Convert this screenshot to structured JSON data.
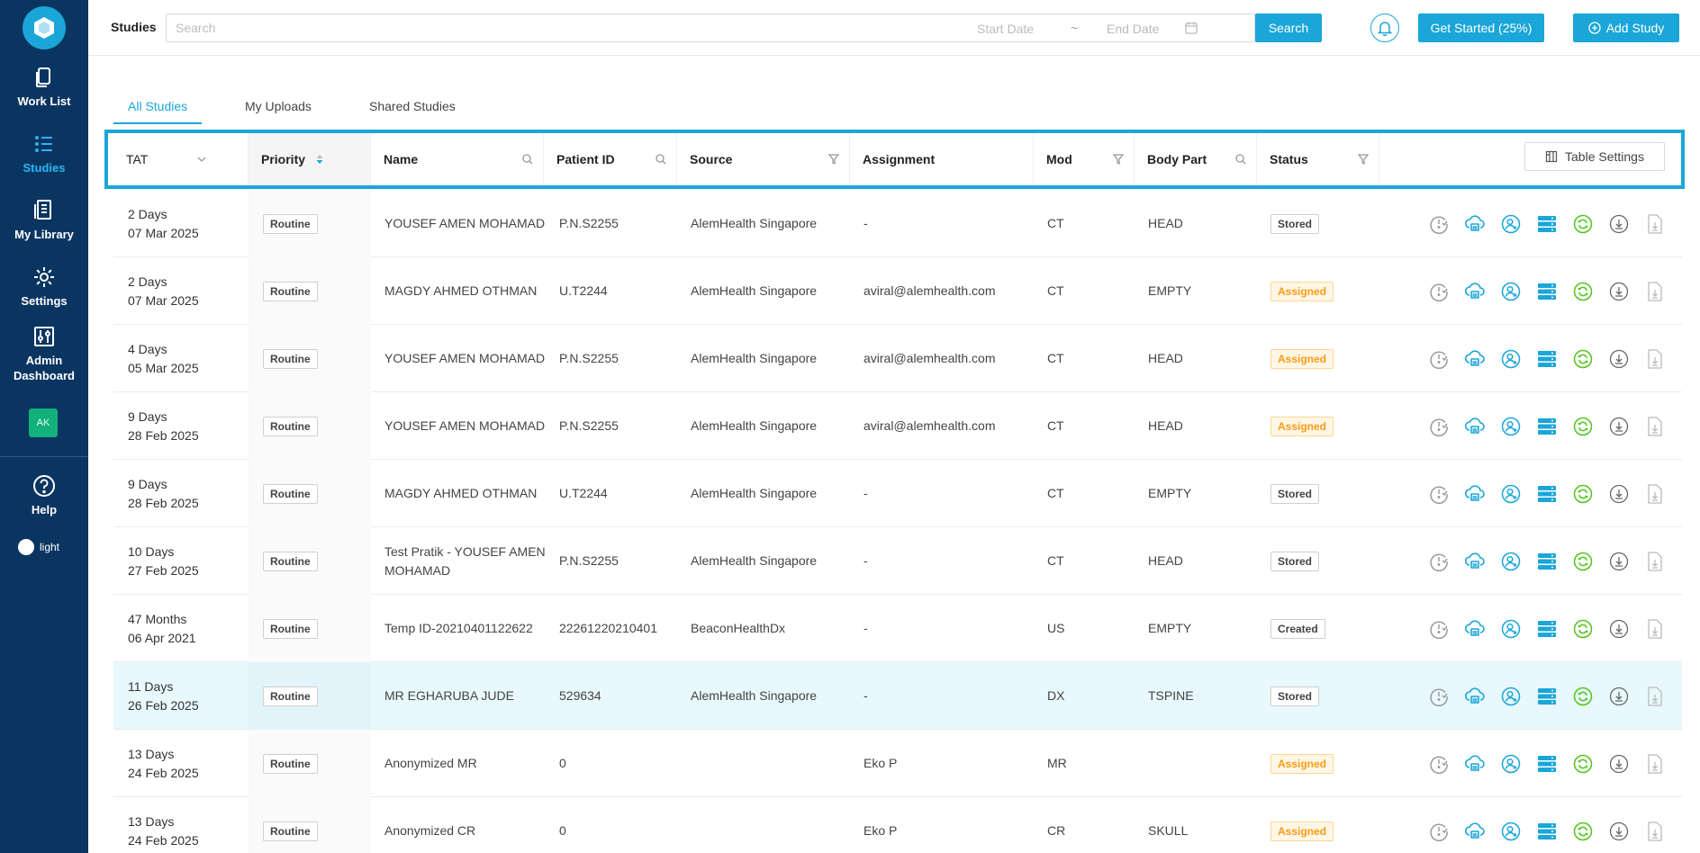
{
  "sidebar": {
    "items": [
      {
        "label": "Work List",
        "icon": "worklist-icon"
      },
      {
        "label": "Studies",
        "icon": "list-icon"
      },
      {
        "label": "My Library",
        "icon": "library-icon"
      },
      {
        "label": "Settings",
        "icon": "gear-icon"
      },
      {
        "label": "Admin Dashboard",
        "icon": "sliders-icon"
      }
    ],
    "avatar": "AK",
    "help": "Help",
    "theme": "light"
  },
  "topbar": {
    "title": "Studies",
    "search_placeholder": "Search",
    "start_date": "Start Date",
    "separator": "~",
    "end_date": "End Date",
    "search_button": "Search",
    "get_started": "Get Started (25%)",
    "add_study": "Add Study"
  },
  "tabs": [
    "All Studies",
    "My Uploads",
    "Shared Studies"
  ],
  "table": {
    "headers": {
      "tat": "TAT",
      "priority": "Priority",
      "name": "Name",
      "patient_id": "Patient ID",
      "source": "Source",
      "assignment": "Assignment",
      "mod": "Mod",
      "body_part": "Body Part",
      "status": "Status"
    },
    "table_settings": "Table Settings",
    "rows": [
      {
        "tat": "2 Days",
        "date": "07 Mar 2025",
        "priority": "Routine",
        "name": "YOUSEF AMEN MOHAMAD",
        "patient_id": "P.N.S2255",
        "source": "AlemHealth Singapore",
        "assignment": "-",
        "mod": "CT",
        "body_part": "HEAD",
        "status": "Stored"
      },
      {
        "tat": "2 Days",
        "date": "07 Mar 2025",
        "priority": "Routine",
        "name": "MAGDY AHMED OTHMAN",
        "patient_id": "U.T2244",
        "source": "AlemHealth Singapore",
        "assignment": "aviral@alemhealth.com",
        "mod": "CT",
        "body_part": "EMPTY",
        "status": "Assigned"
      },
      {
        "tat": "4 Days",
        "date": "05 Mar 2025",
        "priority": "Routine",
        "name": "YOUSEF AMEN MOHAMAD",
        "patient_id": "P.N.S2255",
        "source": "AlemHealth Singapore",
        "assignment": "aviral@alemhealth.com",
        "mod": "CT",
        "body_part": "HEAD",
        "status": "Assigned"
      },
      {
        "tat": "9 Days",
        "date": "28 Feb 2025",
        "priority": "Routine",
        "name": "YOUSEF AMEN MOHAMAD",
        "patient_id": "P.N.S2255",
        "source": "AlemHealth Singapore",
        "assignment": "aviral@alemhealth.com",
        "mod": "CT",
        "body_part": "HEAD",
        "status": "Assigned"
      },
      {
        "tat": "9 Days",
        "date": "28 Feb 2025",
        "priority": "Routine",
        "name": "MAGDY AHMED OTHMAN",
        "patient_id": "U.T2244",
        "source": "AlemHealth Singapore",
        "assignment": "-",
        "mod": "CT",
        "body_part": "EMPTY",
        "status": "Stored"
      },
      {
        "tat": "10 Days",
        "date": "27 Feb 2025",
        "priority": "Routine",
        "name": "Test Pratik - YOUSEF AMEN MOHAMAD",
        "patient_id": "P.N.S2255",
        "source": "AlemHealth Singapore",
        "assignment": "-",
        "mod": "CT",
        "body_part": "HEAD",
        "status": "Stored"
      },
      {
        "tat": "47 Months",
        "date": "06 Apr 2021",
        "priority": "Routine",
        "name": "Temp ID-20210401122622",
        "patient_id": "22261220210401",
        "source": "BeaconHealthDx",
        "assignment": "-",
        "mod": "US",
        "body_part": "EMPTY",
        "status": "Created"
      },
      {
        "tat": "11 Days",
        "date": "26 Feb 2025",
        "priority": "Routine",
        "name": "MR EGHARUBA JUDE",
        "patient_id": "529634",
        "source": "AlemHealth Singapore",
        "assignment": "-",
        "mod": "DX",
        "body_part": "TSPINE",
        "status": "Stored"
      },
      {
        "tat": "13 Days",
        "date": "24 Feb 2025",
        "priority": "Routine",
        "name": "Anonymized MR",
        "patient_id": "0",
        "source": "",
        "assignment": "Eko P",
        "mod": "MR",
        "body_part": "",
        "status": "Assigned"
      },
      {
        "tat": "13 Days",
        "date": "24 Feb 2025",
        "priority": "Routine",
        "name": "Anonymized CR",
        "patient_id": "0",
        "source": "",
        "assignment": "Eko P",
        "mod": "CR",
        "body_part": "SKULL",
        "status": "Assigned"
      }
    ]
  },
  "colors": {
    "sidebar": "#0b3561",
    "accent": "#1aa6d9",
    "assigned": "#fa9b14",
    "highlight_row": "#e8f8fc"
  }
}
